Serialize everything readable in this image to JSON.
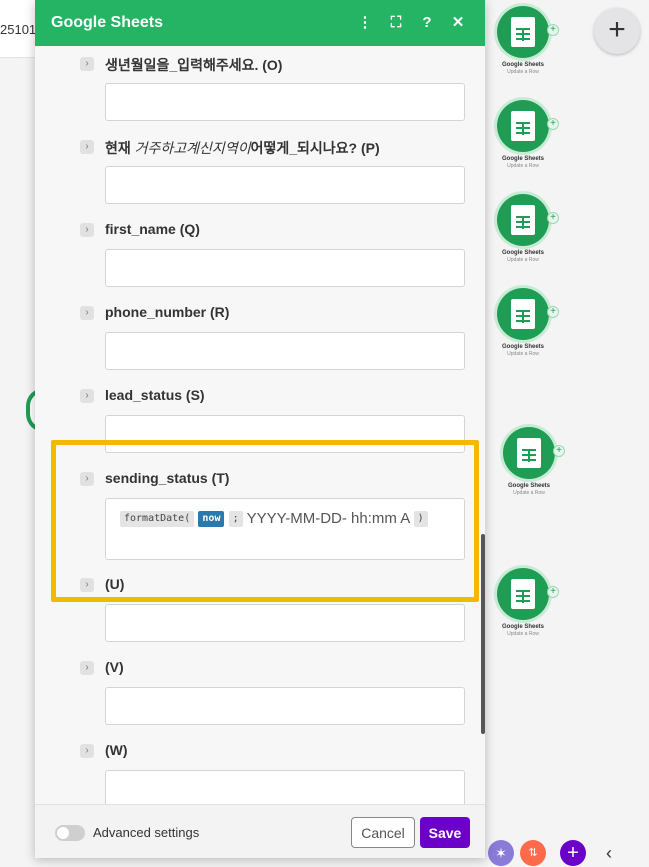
{
  "background": {
    "top_strip_text": "25101",
    "nodes": [
      {
        "title": "Google Sheets",
        "subtitle": "Update a Row"
      },
      {
        "title": "Google Sheets",
        "subtitle": "Update a Row"
      },
      {
        "title": "Google Sheets",
        "subtitle": "Update a Row"
      },
      {
        "title": "Google Sheets",
        "subtitle": "Update a Row"
      },
      {
        "title": "Google Sheets",
        "subtitle": "Update a Row"
      },
      {
        "title": "Google Sheets",
        "subtitle": "Update a Row"
      }
    ],
    "add_button": "+",
    "bottom_icons": [
      "tools-icon",
      "flow-icon",
      "add-icon",
      "collapse-icon"
    ]
  },
  "panel": {
    "title": "Google Sheets",
    "header_icons": [
      "⋮",
      "⛶",
      "?",
      "✕"
    ],
    "fields": [
      {
        "label": "생년월일을_입력해주세요. (O)",
        "value": ""
      },
      {
        "label_prefix": "현재",
        "label_italic": "거주하고계신지역이",
        "label_suffix": "어떻게_되시나요? (P)",
        "value": ""
      },
      {
        "label": "first_name (Q)",
        "value": ""
      },
      {
        "label": "phone_number (R)",
        "value": ""
      },
      {
        "label": "lead_status (S)",
        "value": ""
      },
      {
        "label": "sending_status (T)",
        "tokens": {
          "fn": "formatDate(",
          "var": "now",
          "sep": ";",
          "text": "YYYY-MM-DD- hh:mm A",
          "close": ")"
        }
      },
      {
        "label": "(U)",
        "value": ""
      },
      {
        "label": "(V)",
        "value": ""
      },
      {
        "label": "(W)",
        "value": ""
      }
    ],
    "footer": {
      "advanced_label": "Advanced settings",
      "cancel_label": "Cancel",
      "save_label": "Save"
    }
  },
  "colors": {
    "header_green": "#25b464",
    "highlight": "#f5b800",
    "save_purple": "#6b00c9",
    "token_blue": "#2a7ab0"
  }
}
